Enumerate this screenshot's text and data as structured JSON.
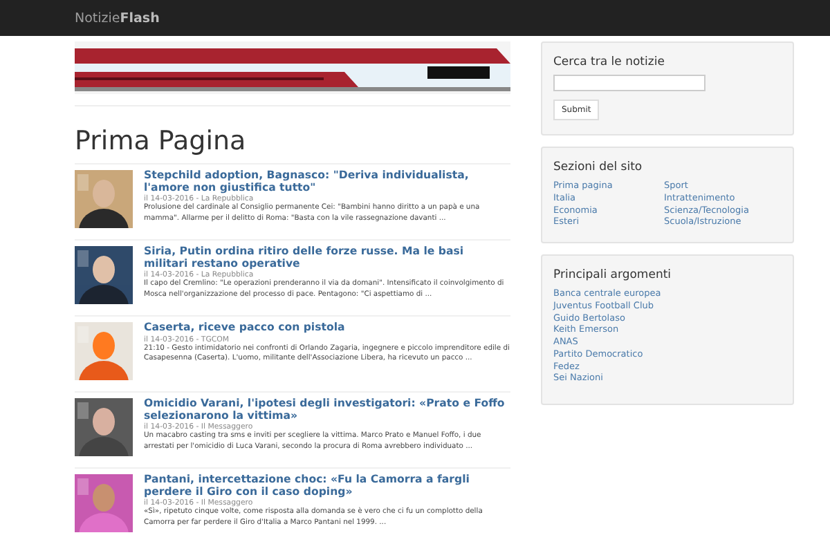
{
  "navbar": {
    "brand_light": "Notizie",
    "brand_bold": "Flash"
  },
  "heading": "Prima Pagina",
  "articles": [
    {
      "title": "Stepchild adoption, Bagnasco: \"Deriva individualista, l'amore non giustifica tutto\"",
      "meta": "il 14-03-2016 - La Repubblica",
      "snippet": "Prolusione del cardinale al Consiglio permanente Cei: \"Bambini hanno diritto a un papà e una mamma\". Allarme per il delitto di Roma: \"Basta con la vile rassegnazione davanti ..."
    },
    {
      "title": "Siria, Putin ordina ritiro delle forze russe. Ma le basi militari restano operative",
      "meta": "il 14-03-2016 - La Repubblica",
      "snippet": "Il capo del Cremlino: \"Le operazioni prenderanno il via da domani\". Intensificato il coinvolgimento di Mosca nell'organizzazione del processo di pace. Pentagono: \"Ci aspettiamo di ..."
    },
    {
      "title": "Caserta, riceve pacco con pistola",
      "meta": "il 14-03-2016 - TGCOM",
      "snippet": "21:10 - Gesto intimidatorio nei confronti di Orlando Zagaria, ingegnere e piccolo imprenditore edile di Casapesenna (Caserta). L'uomo, militante dell'Associazione Libera, ha ricevuto un pacco ..."
    },
    {
      "title": "Omicidio Varani, l'ipotesi degli investigatori: «Prato e Foffo selezionarono la vittima»",
      "meta": "il 14-03-2016 - Il Messaggero",
      "snippet": "Un macabro casting tra sms e inviti per scegliere la vittima. Marco Prato e Manuel Foffo, i due arrestati per l'omicidio di Luca Varani, secondo la procura di Roma avrebbero individuato ..."
    },
    {
      "title": "Pantani, intercettazione choc: «Fu la Camorra a fargli perdere il Giro con il caso doping»",
      "meta": "il 14-03-2016 - Il Messaggero",
      "snippet": "«Sì», ripetuto cinque volte, come risposta alla domanda se è vero che ci fu un complotto della Camorra per far perdere il Giro d'Italia a Marco Pantani nel 1999. ..."
    }
  ],
  "search": {
    "title": "Cerca tra le notizie",
    "button": "Submit"
  },
  "sections": {
    "title": "Sezioni del sito",
    "columns": [
      [
        "Prima pagina",
        "Italia",
        "Economia",
        "Esteri"
      ],
      [
        "Sport",
        "Intrattenimento",
        "Scienza/Tecnologia",
        "Scuola/Istruzione"
      ]
    ]
  },
  "topics": {
    "title": "Principali argomenti",
    "items": [
      "Banca centrale europea",
      "Juventus Football Club",
      "Guido Bertolaso",
      "Keith Emerson",
      "ANAS",
      "Partito Democratico",
      "Fedez",
      "Sei Nazioni"
    ]
  }
}
